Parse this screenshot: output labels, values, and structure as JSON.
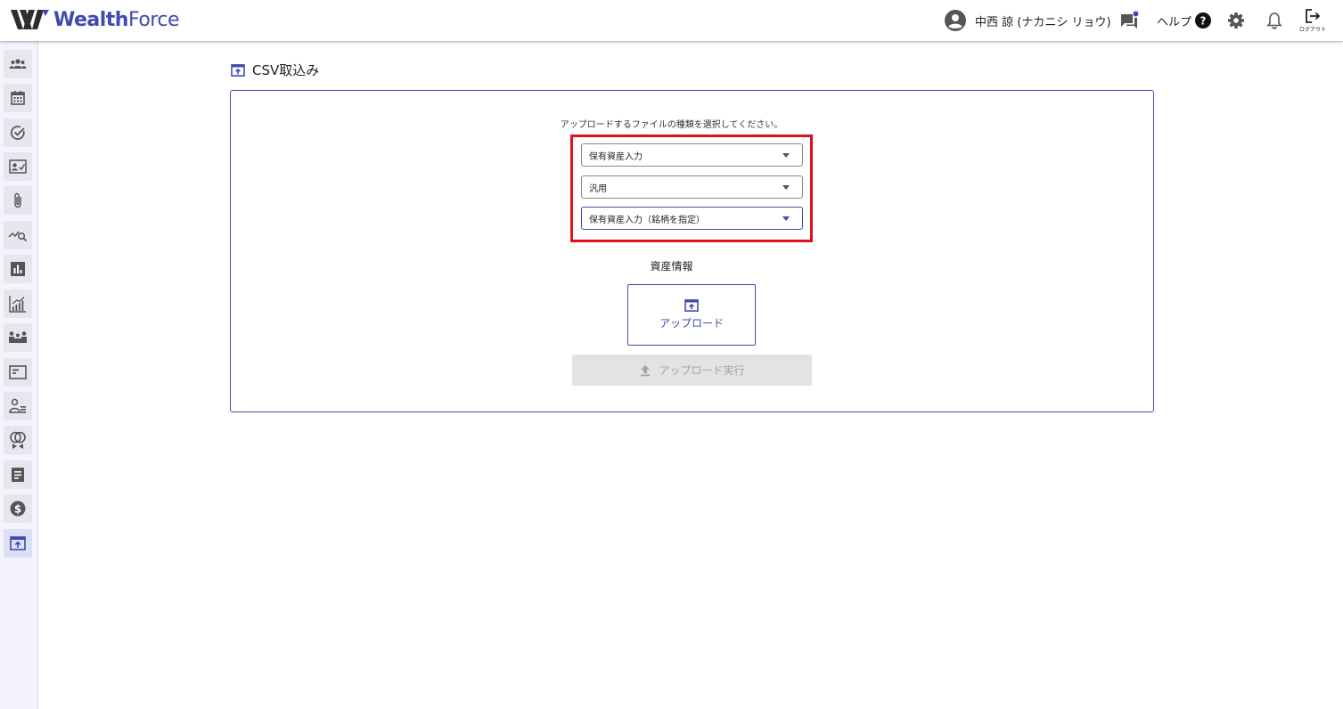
{
  "app": {
    "logo_text_1": "Wealth",
    "logo_text_2": "Force"
  },
  "header": {
    "user_name": "中西 諒 (ナカニシ リョウ)",
    "help_label": "ヘルプ",
    "logout_label": "ログアウト"
  },
  "sidebar": {
    "items": [
      {
        "icon": "people-icon"
      },
      {
        "icon": "calendar-icon"
      },
      {
        "icon": "check-circle-icon"
      },
      {
        "icon": "contact-card-icon"
      },
      {
        "icon": "attachment-icon"
      },
      {
        "icon": "chart-search-icon"
      },
      {
        "icon": "bar-chart-icon"
      },
      {
        "icon": "growth-chart-icon"
      },
      {
        "icon": "meeting-icon"
      },
      {
        "icon": "document-window-icon"
      },
      {
        "icon": "user-list-icon"
      },
      {
        "icon": "gender-icon"
      },
      {
        "icon": "notes-icon"
      },
      {
        "icon": "dollar-icon"
      },
      {
        "icon": "upload-box-icon",
        "active": true
      }
    ]
  },
  "page": {
    "title": "CSV取込み"
  },
  "form": {
    "instruction": "アップロードするファイルの種類を選択してください。",
    "selects": [
      {
        "value": "保有資産入力"
      },
      {
        "value": "汎用"
      },
      {
        "value": "保有資産入力（銘柄を指定）"
      }
    ],
    "section_label": "資産情報",
    "upload_label": "アップロード",
    "execute_label": "アップロード実行"
  },
  "colors": {
    "accent": "#3f4bb0",
    "highlight": "#e0101e",
    "disabled_bg": "#e3e3e3"
  }
}
